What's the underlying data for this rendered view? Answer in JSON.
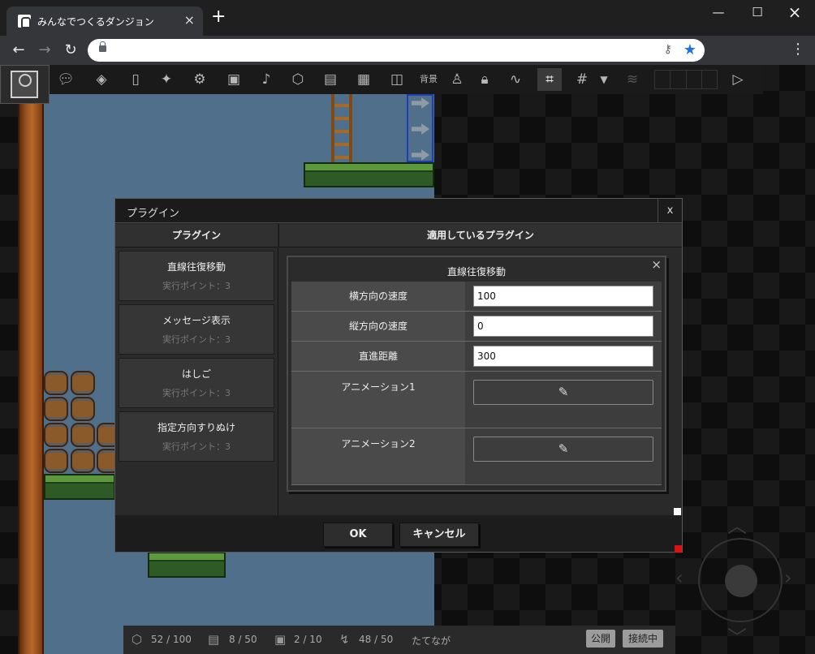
{
  "browser": {
    "tab_title": "みんなでつくるダンジョン",
    "tab_close": "×",
    "new_tab": "+",
    "address": ""
  },
  "toolbar": {
    "tools": [
      "speech-bubble-icon",
      "map-layers-icon",
      "door-icon",
      "gamepad-icon",
      "gear-icon",
      "image-icon",
      "music-note-icon",
      "cube-icon",
      "film-icon",
      "save-icon",
      "puzzle-icon",
      "bgm-label",
      "person-icon",
      "lock-icon",
      "path-icon",
      "cursor-grid-icon",
      "grid-icon",
      "dropdown-arrow-icon",
      "layers-icon",
      "play-icon"
    ],
    "bgm_label": "背景",
    "dropdown_arrow": "▼"
  },
  "dialog": {
    "title": "プラグイン",
    "close_label": "x",
    "left_header": "プラグイン",
    "right_header": "適用しているプラグイン",
    "plugins": [
      {
        "name": "直線往復移動",
        "sub": "実行ポイント：3"
      },
      {
        "name": "メッセージ表示",
        "sub": "実行ポイント：3"
      },
      {
        "name": "はしご",
        "sub": "実行ポイント：3"
      },
      {
        "name": "指定方向すりぬけ",
        "sub": "実行ポイント：3"
      }
    ],
    "applied": {
      "title": "直線往復移動",
      "close_label": "×",
      "params": [
        {
          "label": "横方向の速度",
          "value": "100"
        },
        {
          "label": "縦方向の速度",
          "value": "0"
        },
        {
          "label": "直進距離",
          "value": "300"
        }
      ],
      "animations": [
        {
          "label": "アニメーション1",
          "button_icon": "pencil-icon"
        },
        {
          "label": "アニメーション2",
          "button_icon": "pencil-icon"
        }
      ]
    },
    "ok_label": "OK",
    "cancel_label": "キャンセル"
  },
  "status": {
    "objects": "52 / 100",
    "frames": "8 / 50",
    "images": "2 / 10",
    "points": "48 / 50",
    "name": "たてなが",
    "publish": "公開",
    "connected": "接続中"
  }
}
